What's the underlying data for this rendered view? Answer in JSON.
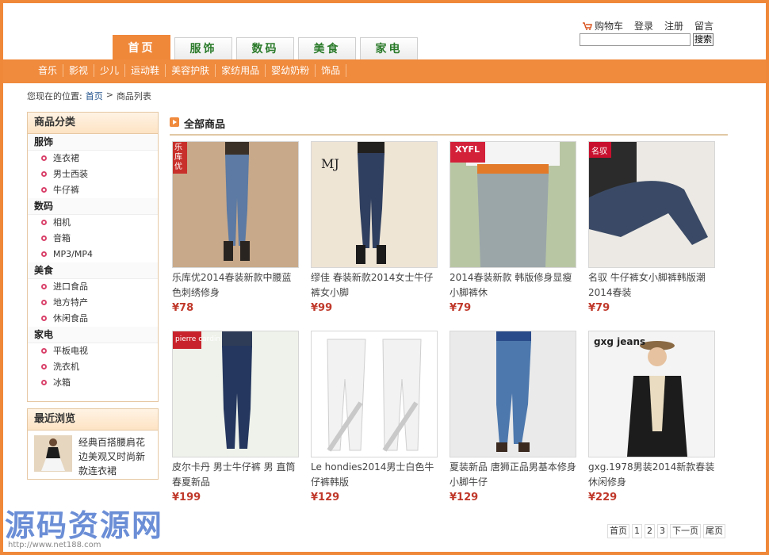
{
  "header": {
    "links": [
      "购物车",
      "登录",
      "注册",
      "留言"
    ],
    "search_button": "搜索",
    "tabs": [
      "首页",
      "服饰",
      "数码",
      "美食",
      "家电"
    ],
    "active_tab": 0,
    "categories": [
      "音乐",
      "影视",
      "少儿",
      "运动鞋",
      "美容护肤",
      "家纺用品",
      "婴幼奶粉",
      "饰品"
    ]
  },
  "breadcrumb": {
    "prefix": "您现在的位置:",
    "home": "首页",
    "sep": ">",
    "current": "商品列表"
  },
  "sidebar": {
    "title": "商品分类",
    "groups": [
      {
        "title": "服饰",
        "items": [
          "连衣裙",
          "男士西装",
          "牛仔裤"
        ]
      },
      {
        "title": "数码",
        "items": [
          "相机",
          "音箱",
          "MP3/MP4"
        ]
      },
      {
        "title": "美食",
        "items": [
          "进口食品",
          "地方特产",
          "休闲食品"
        ]
      },
      {
        "title": "家电",
        "items": [
          "平板电视",
          "洗衣机",
          "冰箱"
        ]
      }
    ],
    "recent_title": "最近浏览",
    "recent_item": "经典百搭腰肩花边美观又时尚新款连衣裙"
  },
  "main": {
    "title": "全部商品",
    "products": [
      {
        "name": "乐库优2014春装新款中腰蓝色刺绣修身",
        "price": "¥78",
        "badge": "乐库优"
      },
      {
        "name": "缪佳 春装新款2014女士牛仔裤女小脚",
        "price": "¥99",
        "badge": "MJ"
      },
      {
        "name": "2014春装新款 韩版修身显瘦小脚裤休",
        "price": "¥79",
        "badge": "XYFL"
      },
      {
        "name": "名驭 牛仔裤女小脚裤韩版潮2014春装",
        "price": "¥79",
        "badge": "名驭"
      },
      {
        "name": "皮尔卡丹 男士牛仔裤 男 直筒 春夏新品",
        "price": "¥199",
        "badge": "pierre cardin"
      },
      {
        "name": "Le hondies2014男士白色牛仔裤韩版",
        "price": "¥129",
        "badge": ""
      },
      {
        "name": "夏装新品 唐狮正品男基本修身小脚牛仔",
        "price": "¥129",
        "badge": ""
      },
      {
        "name": "gxg.1978男装2014新款春装休闲修身",
        "price": "¥229",
        "badge": "gxg jeans"
      }
    ]
  },
  "pager": [
    "首页",
    "1",
    "2",
    "3",
    "下一页",
    "尾页"
  ],
  "watermark": {
    "text": "源码资源网",
    "url": "http://www.net188.com"
  },
  "colors": {
    "accent": "#f08a3c",
    "price": "#c0392b",
    "tab_text": "#2a7a2a"
  }
}
